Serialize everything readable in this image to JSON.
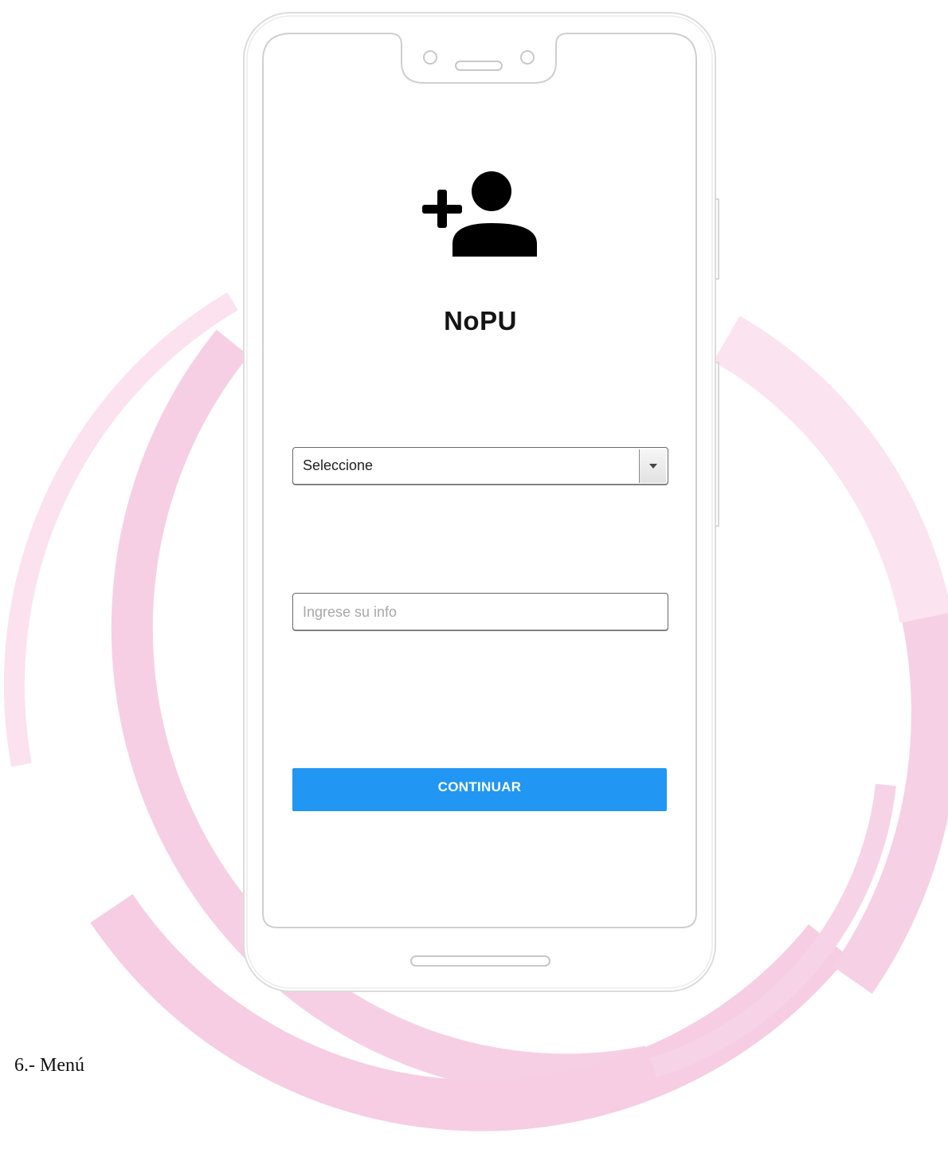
{
  "app": {
    "name": "NoPU",
    "icon": "person-add-icon"
  },
  "form": {
    "select_value": "Seleccione",
    "info_placeholder": "Ingrese su info",
    "continue_label": "CONTINUAR"
  },
  "caption": "6.- Menú",
  "colors": {
    "primary": "#2196f3",
    "ring": "#f8d3e6",
    "title": "#141414",
    "frame": "#dcdcdc"
  }
}
